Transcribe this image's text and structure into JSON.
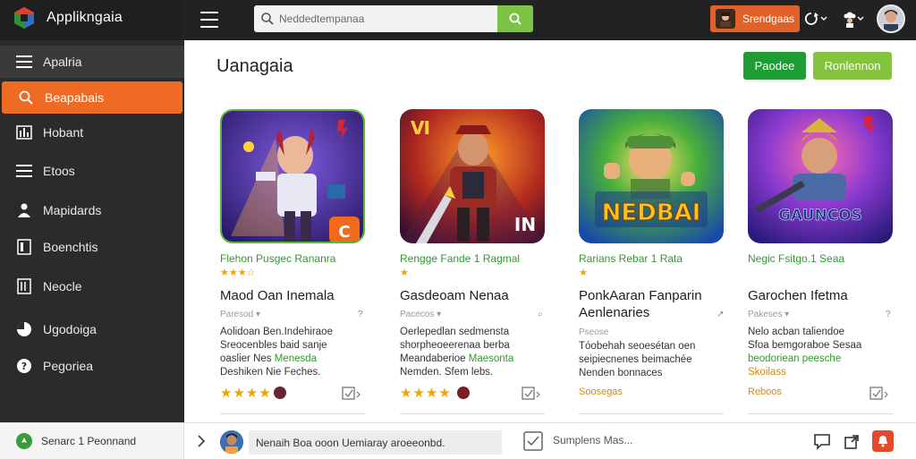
{
  "app": {
    "title": "Applikngaia"
  },
  "search": {
    "placeholder": "Neddedtempanaa"
  },
  "user_chip": {
    "label": "Srendgaas"
  },
  "sidebar": {
    "items": [
      {
        "label": "Apalria",
        "icon": "menu-icon"
      },
      {
        "label": "Beapabais",
        "icon": "search-icon"
      },
      {
        "label": "Hobant",
        "icon": "chart-icon"
      },
      {
        "label": "Etoos",
        "icon": "list-icon"
      },
      {
        "label": "Mapidards",
        "icon": "person-icon"
      },
      {
        "label": "Boenchtis",
        "icon": "document-icon"
      },
      {
        "label": "Neocle",
        "icon": "page-icon"
      },
      {
        "label": "Ugodoiga",
        "icon": "clock-icon"
      },
      {
        "label": "Pegoriea",
        "icon": "help-icon"
      }
    ],
    "active_index": 1
  },
  "main": {
    "title": "Uanagaia",
    "primary_button": "Paodee",
    "secondary_button": "Ronlennon"
  },
  "cards": [
    {
      "genre": "Flehon Pusgec Rananra",
      "stars_top": "★★★☆",
      "name": "Maod Oan Inemala",
      "sub": "Paresod ▾",
      "sub_icon": "?",
      "desc_lines": [
        "Aolidoan Ben.Indehiraoe",
        "Sreocenbles baid sanje"
      ],
      "desc_tail": "oaslier Nes ",
      "desc_hl": "Menesda",
      "desc_line4": "Deshiken Nie Feches.",
      "stars_bottom": "★★★★",
      "price": "",
      "accent": "#e1612b"
    },
    {
      "genre": "Rengge Fande 1 Ragmal",
      "stars_top": "★",
      "name": "Gasdeoam Nenaa",
      "sub": "Pacecos ▾",
      "sub_icon": "⌕",
      "desc_lines": [
        "Oerlepedlan sedmensta",
        "shorpheoeerenaa berba"
      ],
      "desc_tail": "Meandaberioe ",
      "desc_hl": "Maesonta",
      "desc_line4": "Nemden. Sfem lebs.",
      "stars_bottom": "★★★★",
      "price": "",
      "accent": "#7a1f25"
    },
    {
      "genre": "Rarians Rebar 1 Rata",
      "stars_top": "★",
      "name": "PonkAaran Fanparin Aenlenaries",
      "sub": "Pseose",
      "sub_icon": "↗",
      "desc_lines": [
        "Tóobehah seoesétan oen",
        "seipiecnenes beimachée"
      ],
      "desc_tail": "",
      "desc_hl": "",
      "desc_line4": "Nenden bonnaces",
      "stars_bottom": "",
      "price": "Soosegas",
      "accent": "#2f6fc2"
    },
    {
      "genre": "Negic Fsitgo.1 Seaa",
      "stars_top": "",
      "name": "Garochen Ifetma",
      "sub": "Pakeses ▾",
      "sub_icon": "?",
      "desc_lines": [
        "Nelo acban taliendoe",
        "Sfoa bemgoraboe Sesaa"
      ],
      "desc_tail": "",
      "desc_hl": "beodoriean peesche",
      "desc_line4": "Skoilass",
      "stars_bottom": "",
      "price": "Reboos",
      "accent": "#7c3fc4"
    }
  ],
  "card_art_text": {
    "c2": "IN",
    "c3": "NEDBAI",
    "c4": "GAUNCOS"
  },
  "footer": {
    "status": "Senarc 1 Peonnand",
    "message": "Nenaih Boa ooon Uemiaray aroeeonbd.",
    "suggest": "Sumplens Mas..."
  }
}
